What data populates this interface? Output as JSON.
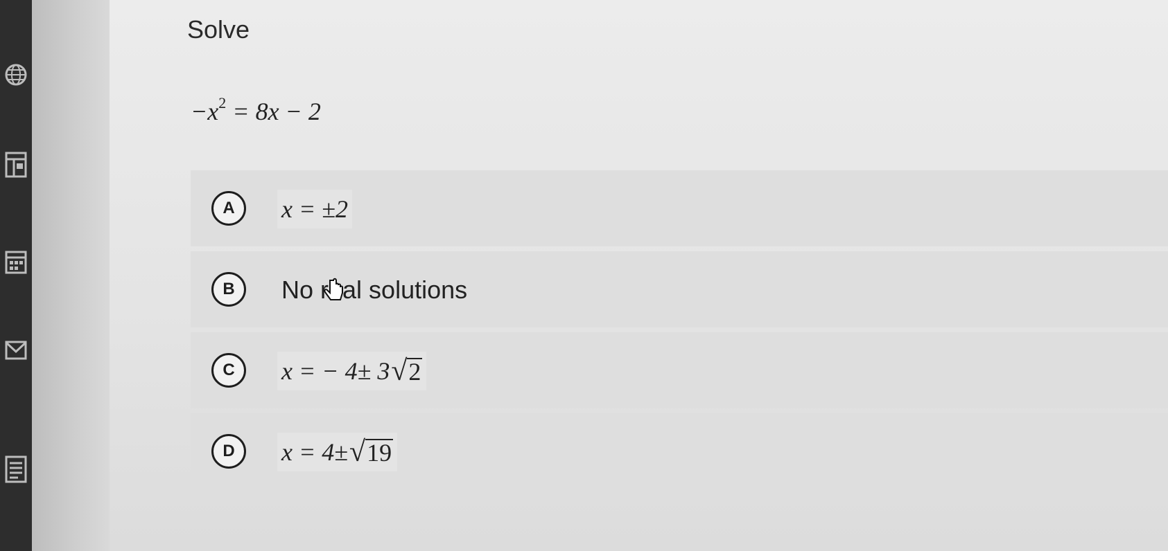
{
  "prompt": {
    "title": "Solve"
  },
  "equation": {
    "lhs": "−x",
    "exp": "2",
    "rest": " = 8x − 2"
  },
  "choices": [
    {
      "letter": "A",
      "lead": "x = ±2",
      "radicand": ""
    },
    {
      "letter": "B",
      "text": "No real solutions"
    },
    {
      "letter": "C",
      "lead": "x = − 4± 3",
      "radicand": "2"
    },
    {
      "letter": "D",
      "lead": "x = 4± ",
      "radicand": "19"
    }
  ],
  "sidebar_icons": [
    "globe-icon",
    "layout-icon",
    "calendar-icon",
    "mail-icon",
    "document-icon"
  ],
  "colors": {
    "rail": "#2d2d2d",
    "page": "#e6e6e6",
    "ink": "#222222"
  }
}
